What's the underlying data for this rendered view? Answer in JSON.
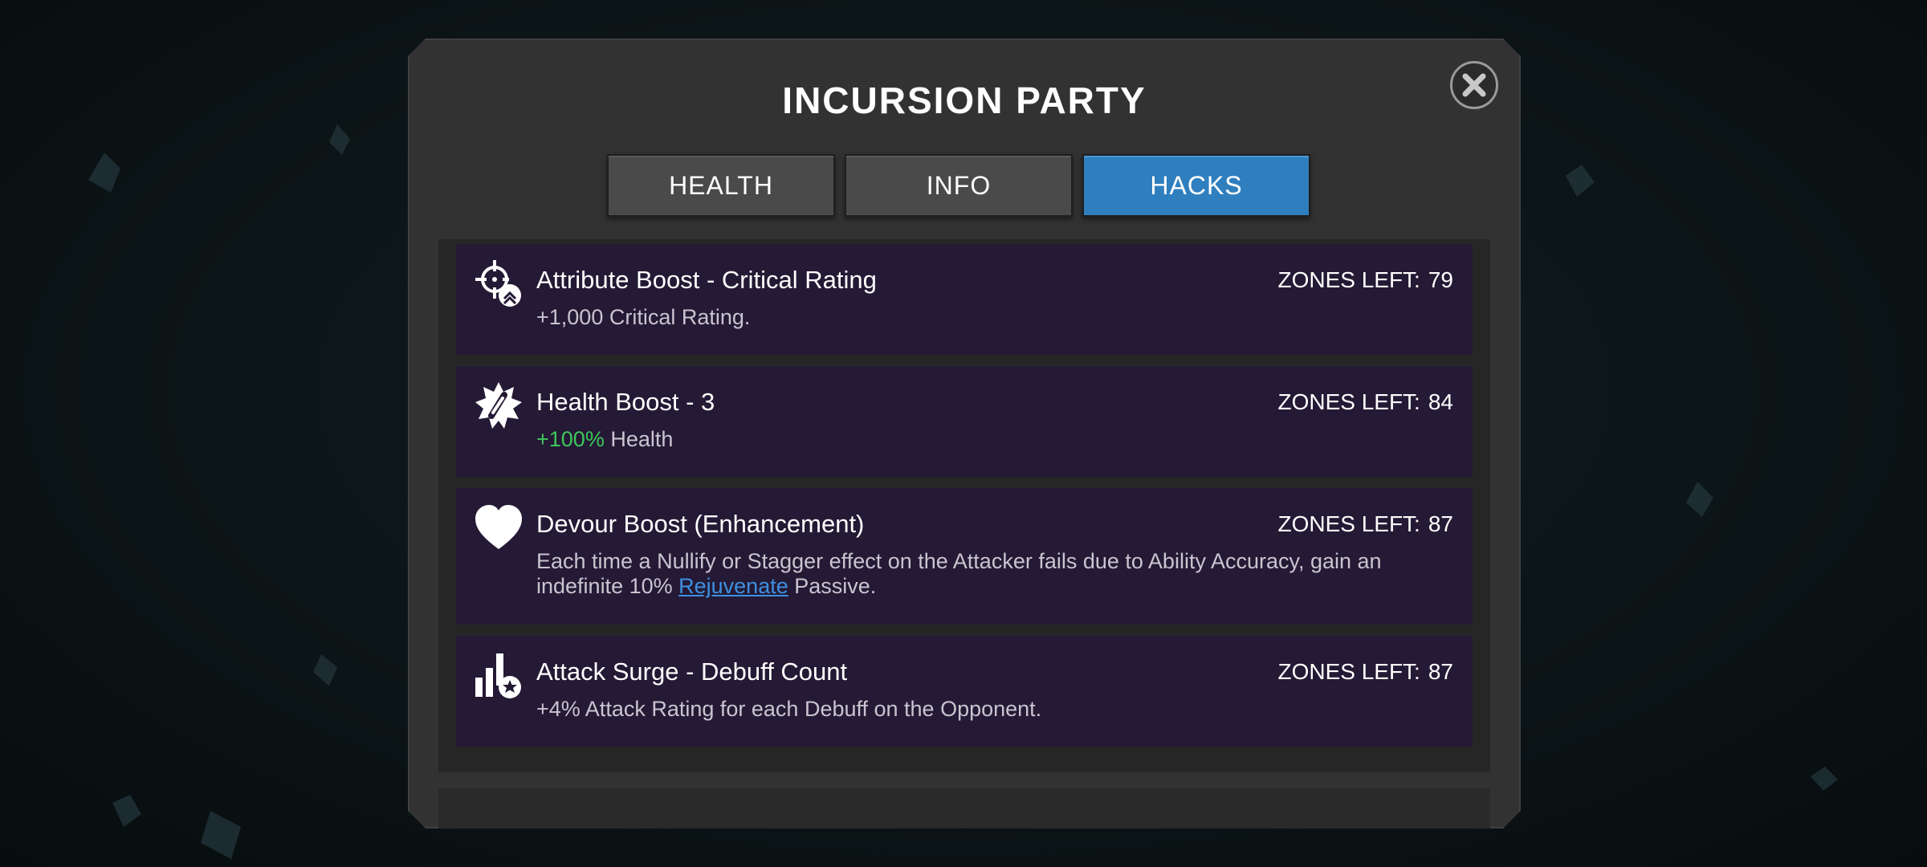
{
  "modal": {
    "title": "INCURSION PARTY",
    "close_icon": "close-x-icon"
  },
  "tabs": [
    {
      "label": "HEALTH",
      "active": false
    },
    {
      "label": "INFO",
      "active": false
    },
    {
      "label": "HACKS",
      "active": true
    }
  ],
  "colors": {
    "active_tab": "#2f7fbf",
    "row_bg": "#241a35",
    "positive_value": "#3ec85a",
    "link": "#3d8fe0"
  },
  "hacks": [
    {
      "icon": "crosshair-chevron-icon",
      "name": "Attribute Boost - Critical Rating",
      "zones_label": "ZONES LEFT:",
      "zones_value": "79",
      "desc": "+1,000 Critical Rating."
    },
    {
      "icon": "starburst-bandage-icon",
      "name": "Health Boost - 3",
      "zones_label": "ZONES LEFT:",
      "zones_value": "84",
      "desc_value": "+100%",
      "desc_rest": "Health"
    },
    {
      "icon": "heart-icon",
      "name": "Devour Boost (Enhancement)",
      "zones_label": "ZONES LEFT:",
      "zones_value": "87",
      "desc_pre": "Each time a Nullify or Stagger effect on the Attacker fails due to Ability Accuracy, gain an indefinite 10%",
      "desc_link": "Rejuvenate",
      "desc_post": "Passive."
    },
    {
      "icon": "bar-chart-star-icon",
      "name": "Attack Surge - Debuff Count",
      "zones_label": "ZONES LEFT:",
      "zones_value": "87",
      "desc": "+4% Attack Rating for each Debuff on the Opponent."
    }
  ]
}
